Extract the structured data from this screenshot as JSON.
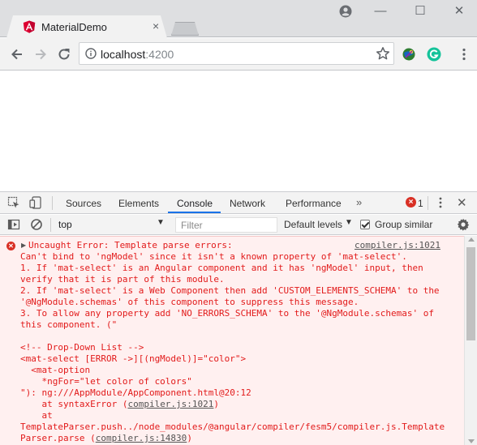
{
  "browser": {
    "tab_title": "MaterialDemo",
    "tab_close": "×",
    "url_host": "localhost",
    "url_port": ":4200",
    "window_minimize": "—",
    "window_maximize": "☐",
    "window_close": "✕",
    "icons": [
      "angular-favicon",
      "user-icon",
      "back-icon",
      "forward-icon",
      "reload-icon",
      "info-icon",
      "star-icon",
      "extension-icon",
      "grammarly-icon",
      "menu-icon"
    ],
    "colors": {
      "angular_red": "#dd0031",
      "grammarly_green": "#15c39a"
    }
  },
  "devtools": {
    "tabs": [
      {
        "label": "Sources"
      },
      {
        "label": "Elements"
      },
      {
        "label": "Console",
        "active": true
      },
      {
        "label": "Network"
      },
      {
        "label": "Performance"
      }
    ],
    "more_tabs": "»",
    "error_count": "1",
    "error_badge": "×",
    "close": "✕",
    "context": "top",
    "filter_placeholder": "Filter",
    "levels_label": "Default levels",
    "group_similar": "Group similar",
    "group_similar_checked": true,
    "accent_color": "#1a73e8"
  },
  "console": {
    "error_source": "compiler.js:1021",
    "lines": [
      "Uncaught Error: Template parse errors:",
      "Can't bind to 'ngModel' since it isn't a known property of 'mat-select'.",
      "1. If 'mat-select' is an Angular component and it has 'ngModel' input, then",
      "verify that it is part of this module.",
      "2. If 'mat-select' is a Web Component then add 'CUSTOM_ELEMENTS_SCHEMA' to the",
      "'@NgModule.schemas' of this component to suppress this message.",
      "3. To allow any property add 'NO_ERRORS_SCHEMA' to the '@NgModule.schemas' of",
      "this component. (\"",
      "",
      "<!-- Drop-Down List -->",
      "<mat-select [ERROR ->][(ngModel)]=\"color\">",
      "  <mat-option",
      "    *ngFor=\"let color of colors\"",
      "\"): ng:///AppModule/AppComponent.html@20:12",
      "    at syntaxError (",
      "    at",
      "TemplateParser.push../node_modules/@angular/compiler/fesm5/compiler.js.Template",
      "Parser.parse ("
    ],
    "link_1": "compiler.js:1021",
    "link_2": "compiler.js:14830",
    "close_paren": ")",
    "error_text_color": "#e21a1a",
    "error_bg_color": "#fff0f0"
  }
}
